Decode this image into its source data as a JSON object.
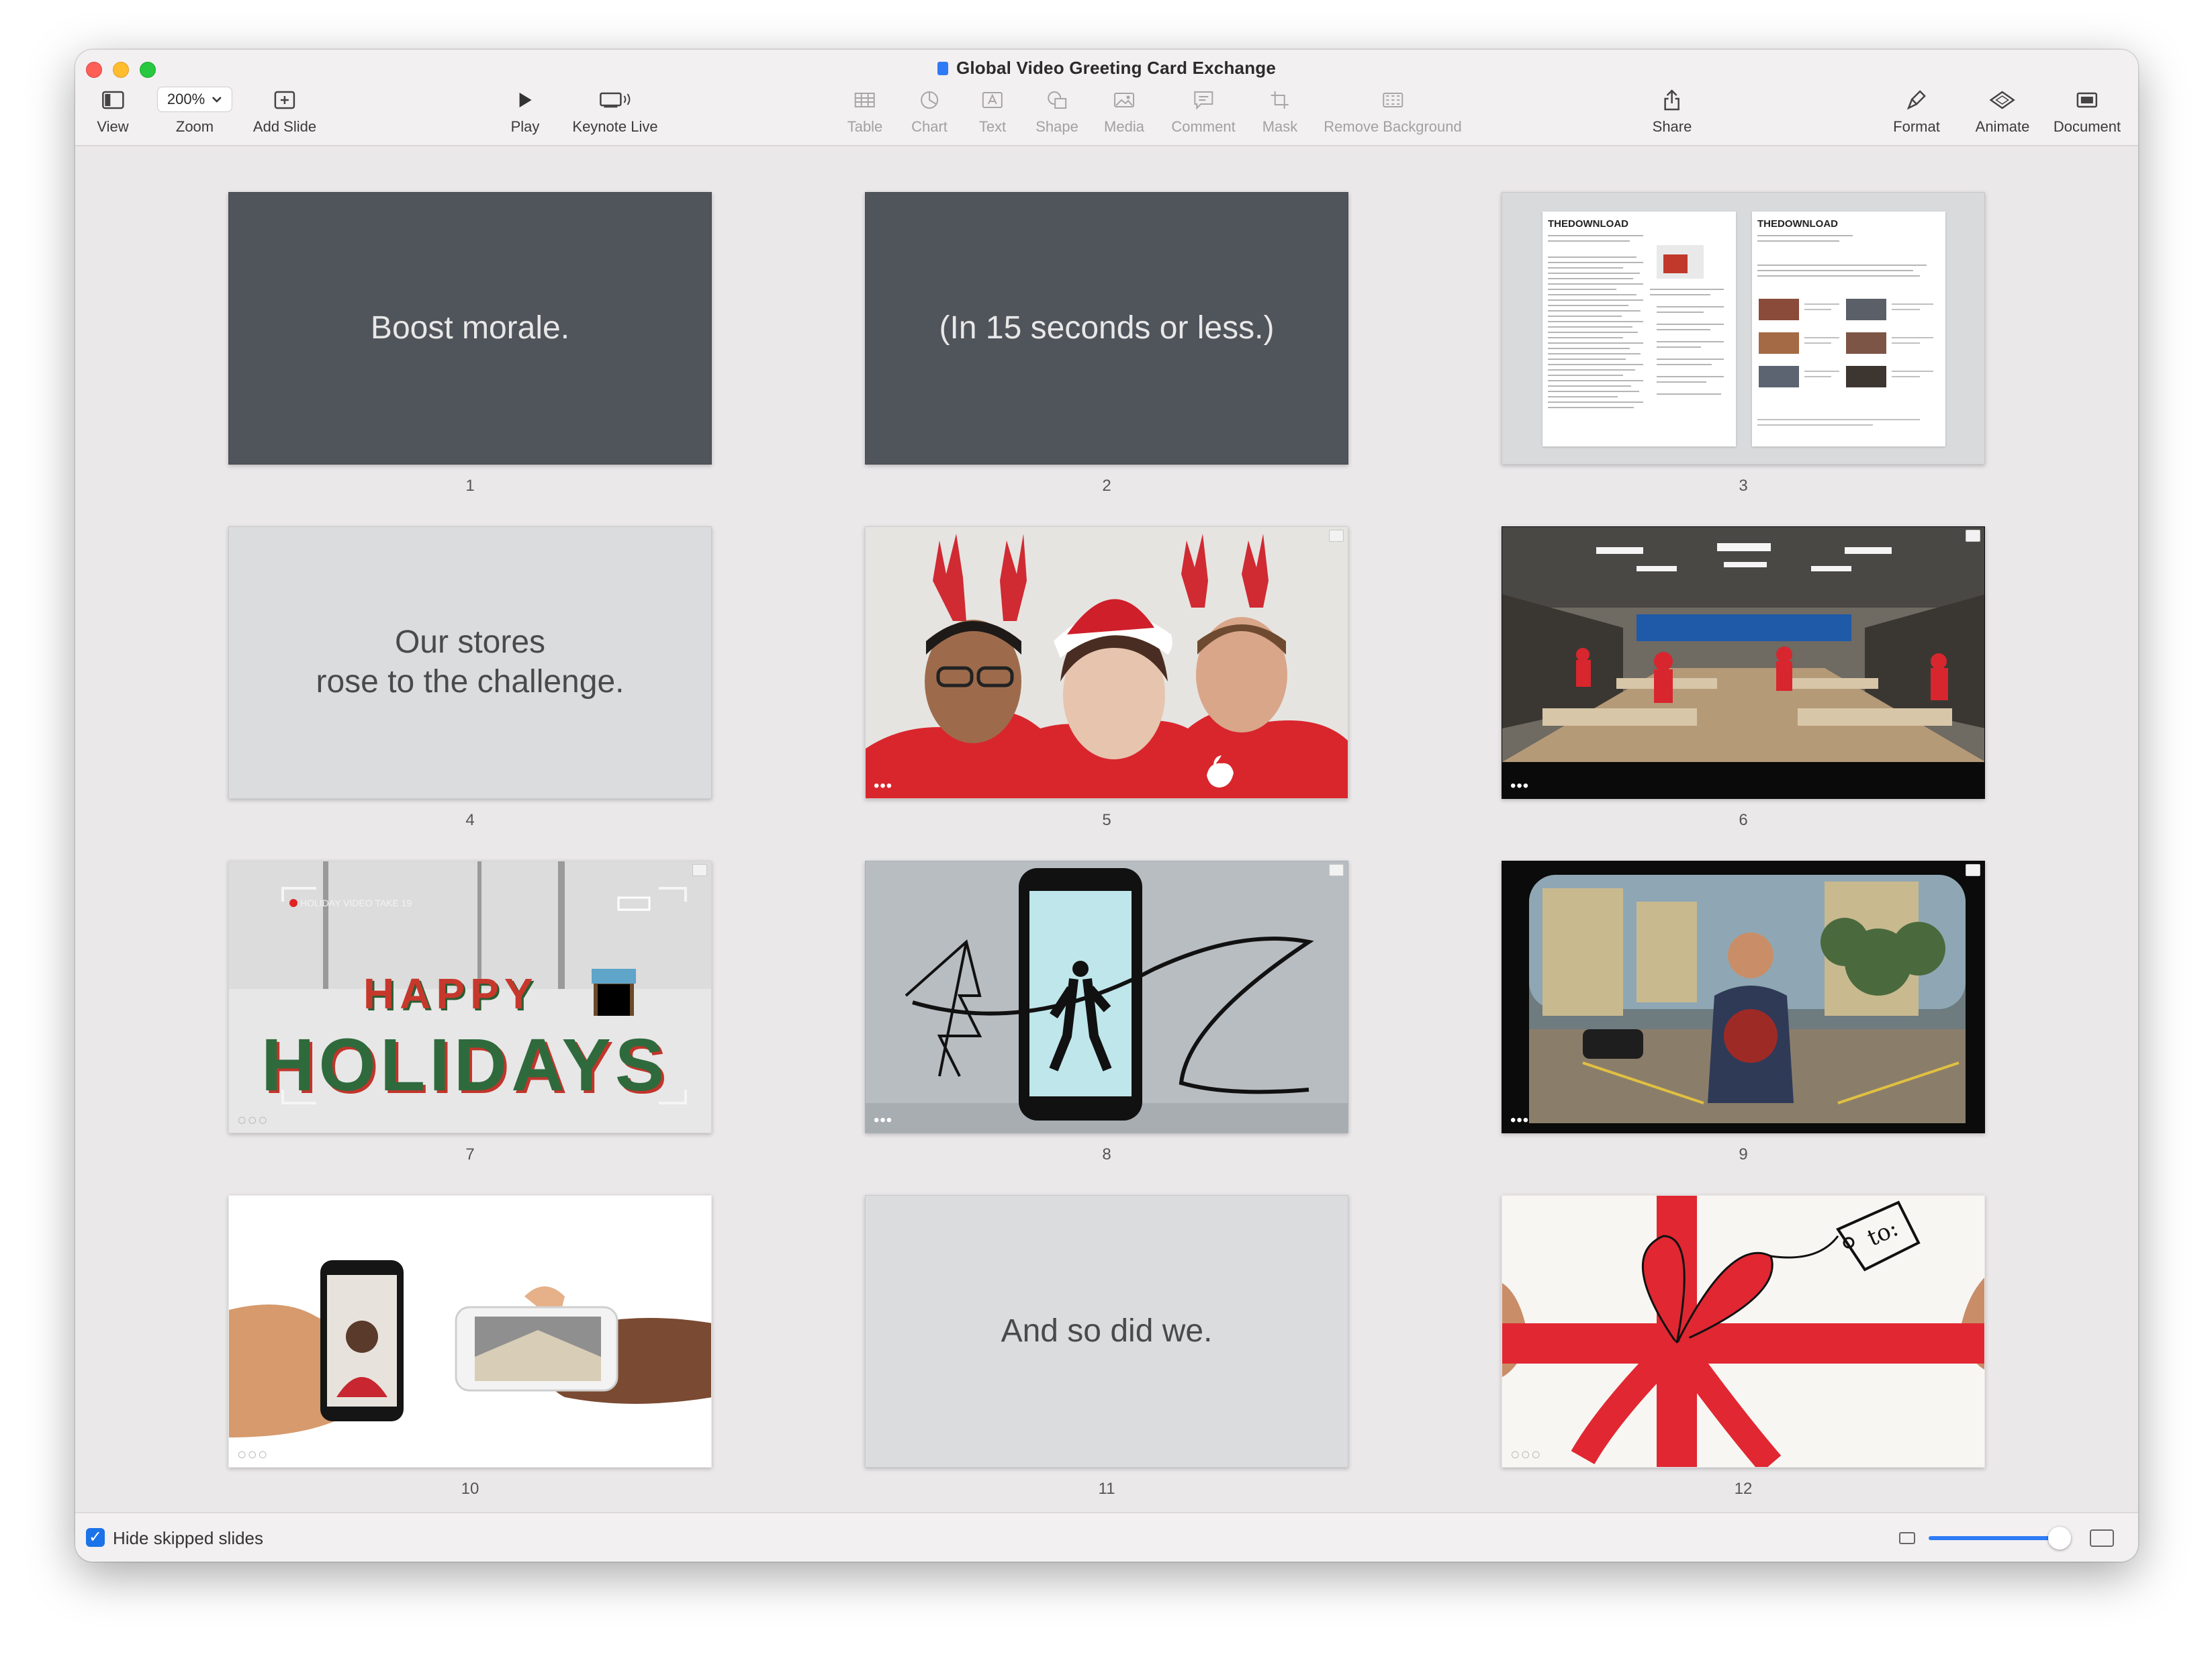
{
  "window": {
    "title": "Global Video Greeting Card Exchange"
  },
  "toolbar": {
    "view": "View",
    "zoom_value": "200%",
    "zoom": "Zoom",
    "add_slide": "Add Slide",
    "play": "Play",
    "keynote_live": "Keynote Live",
    "table": "Table",
    "chart": "Chart",
    "text": "Text",
    "shape": "Shape",
    "media": "Media",
    "comment": "Comment",
    "mask": "Mask",
    "remove_background": "Remove Background",
    "share": "Share",
    "format": "Format",
    "animate": "Animate",
    "document": "Document"
  },
  "slides": [
    {
      "number": "1",
      "text": "Boost morale."
    },
    {
      "number": "2",
      "text": "(In 15 seconds or less.)"
    },
    {
      "number": "3",
      "heading_left": "THEDOWNLOAD",
      "heading_right": "THEDOWNLOAD"
    },
    {
      "number": "4",
      "line1": "Our stores",
      "line2": "rose to the challenge."
    },
    {
      "number": "5"
    },
    {
      "number": "6"
    },
    {
      "number": "7",
      "overlay": "HOLIDAY VIDEO TAKE 19",
      "word1": "HAPPY",
      "word2": "HOLIDAYS"
    },
    {
      "number": "8"
    },
    {
      "number": "9"
    },
    {
      "number": "10"
    },
    {
      "number": "11",
      "text": "And so did we."
    },
    {
      "number": "12",
      "tag_text": "to:"
    }
  ],
  "footer": {
    "hide_skipped": "Hide skipped slides"
  }
}
